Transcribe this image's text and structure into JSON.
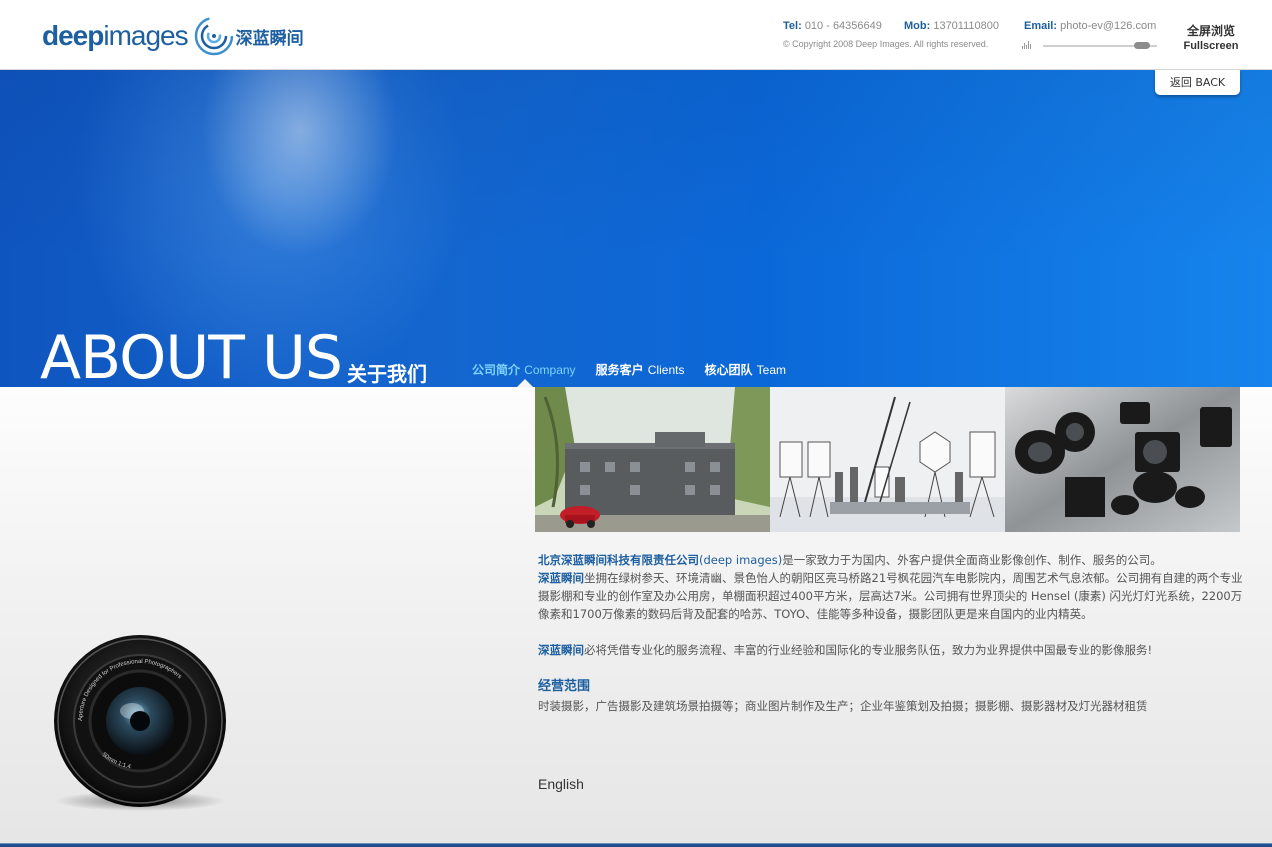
{
  "header": {
    "logo_deep": "deep",
    "logo_images": "images",
    "logo_cn": "深蓝瞬间",
    "tel_label": "Tel:",
    "tel_value": "010 - 64356649",
    "mob_label": "Mob:",
    "mob_value": "13701110800",
    "email_label": "Email:",
    "email_value": "photo-ev@126.com",
    "copyright": "© Copyright 2008 Deep Images. All rights reserved.",
    "volume_level": 0.87,
    "fullscreen_cn": "全屏浏览",
    "fullscreen_en": "Fullscreen"
  },
  "back_button": "返回 BACK",
  "banner": {
    "title": "ABOUT US",
    "title_cn": "关于我们"
  },
  "nav": {
    "items": [
      {
        "cn": "公司简介",
        "en": "Company",
        "active": true
      },
      {
        "cn": "服务客户",
        "en": "Clients",
        "active": false
      },
      {
        "cn": "核心团队",
        "en": "Team",
        "active": false
      }
    ]
  },
  "content": {
    "p1_company": "北京深蓝瞬间科技有限责任公司",
    "p1_brand": "(deep images)",
    "p1_rest": "是一家致力于为国内、外客户提供全面商业影像创作、制作、服务的公司。",
    "p2_brand": "深蓝瞬间",
    "p2_rest": "坐拥在绿树参天、环境清幽、景色怡人的朝阳区亮马桥路21号枫花园汽车电影院内，周围艺术气息浓郁。公司拥有自建的两个专业摄影棚和专业的创作室及办公用房，单棚面积超过400平方米，层高达7米。公司拥有世界顶尖的 Hensel (康素) 闪光灯灯光系统，2200万像素和1700万像素的数码后背及配套的哈苏、TOYO、佳能等多种设备，摄影团队更是来自国内的业内精英。",
    "p3_brand": "深蓝瞬间",
    "p3_rest": "必将凭借专业化的服务流程、丰富的行业经验和国际化的专业服务队伍，致力为业界提供中国最专业的影像服务!",
    "scope_title": "经营范围",
    "scope_text": "时装摄影，广告摄影及建筑场景拍摄等；商业图片制作及生产；企业年鉴策划及拍摄；摄影棚、摄影器材及灯光器材租赁"
  },
  "english_link": "English",
  "lens_text": {
    "ring_top": "Aperture Designed for Professional Photographers",
    "ring_bottom": "50mm 1:1.4"
  }
}
